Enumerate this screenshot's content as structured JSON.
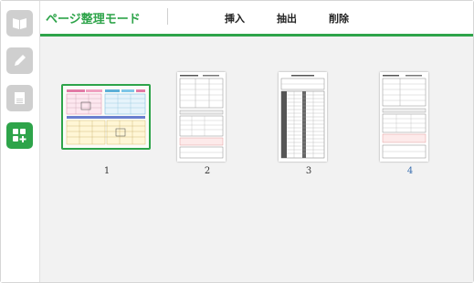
{
  "header": {
    "title": "ページ整理モード",
    "buttons": [
      "挿入",
      "抽出",
      "削除"
    ]
  },
  "sidebar": {
    "items": [
      {
        "icon": "book-icon",
        "active": false
      },
      {
        "icon": "pencil-icon",
        "active": false
      },
      {
        "icon": "document-icon",
        "active": false
      },
      {
        "icon": "grid-add-icon",
        "active": true
      }
    ]
  },
  "pages": [
    {
      "number": "1",
      "selected": true
    },
    {
      "number": "2",
      "selected": false
    },
    {
      "number": "3",
      "selected": false
    },
    {
      "number": "4",
      "selected": false
    }
  ],
  "colors": {
    "accent": "#2ea44a"
  }
}
